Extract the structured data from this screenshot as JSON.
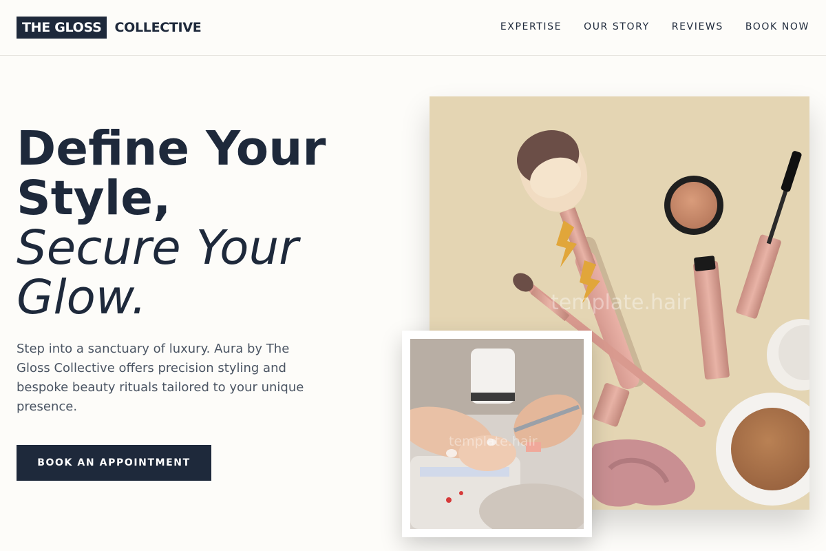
{
  "brand": {
    "logo_box_text": "THE GLOSS",
    "logo_text": "COLLECTIVE"
  },
  "nav": {
    "items": [
      {
        "label": "EXPERTISE"
      },
      {
        "label": "OUR STORY"
      },
      {
        "label": "REVIEWS"
      },
      {
        "label": "BOOK NOW"
      }
    ]
  },
  "hero": {
    "title_line1": "Define Your",
    "title_line2": "Style,",
    "title_line3": "Secure Your",
    "title_line4": "Glow.",
    "description": "Step into a sanctuary of luxury. Aura by The Gloss Collective offers precision styling and bespoke beauty rituals tailored to your unique presence.",
    "cta_label": "BOOK AN APPOINTMENT"
  },
  "images": {
    "main_watermark": "template.hair",
    "inset_watermark": "template.hair"
  },
  "colors": {
    "primary": "#1e293b",
    "background": "#fdfcf9",
    "main_image_bg": "#e4d5b3",
    "accent_pink": "#d9a09a"
  }
}
